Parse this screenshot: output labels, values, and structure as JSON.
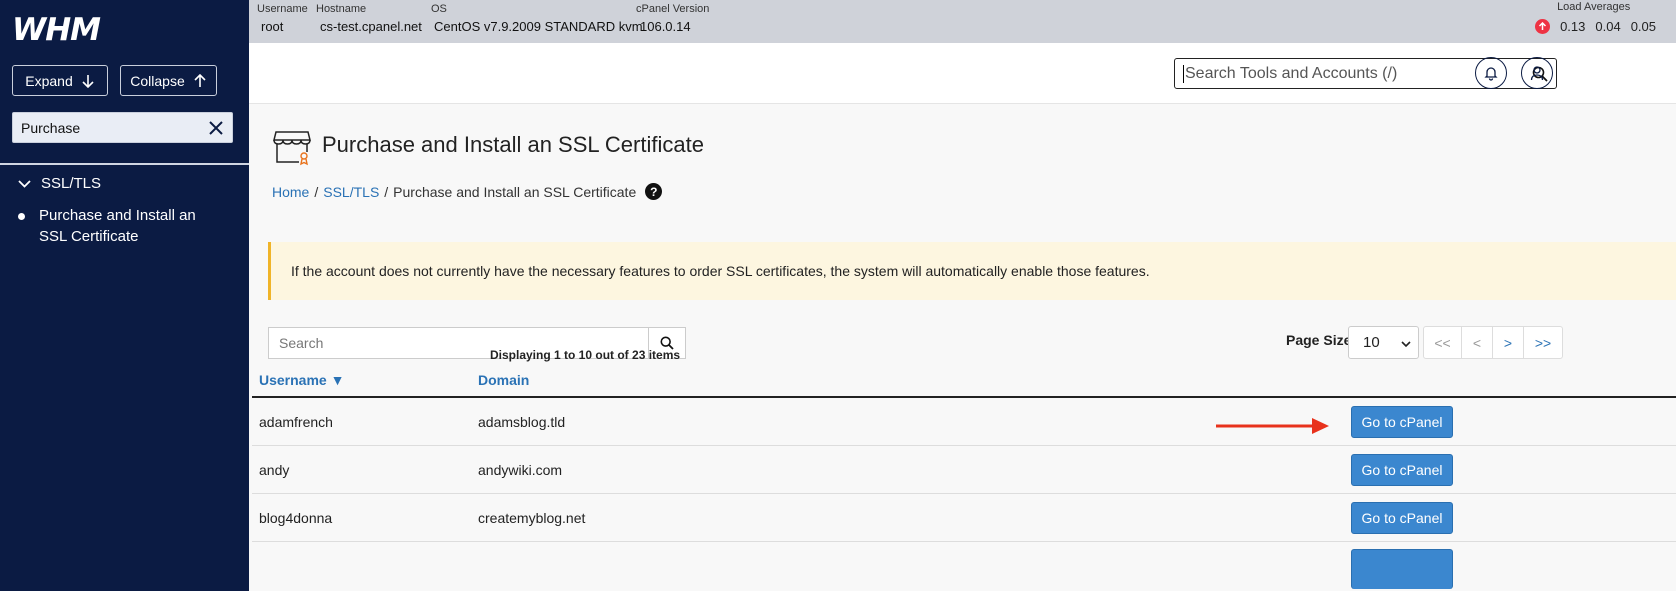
{
  "sidebar": {
    "logo": "WHM",
    "expand_label": "Expand",
    "collapse_label": "Collapse",
    "filter_value": "Purchase",
    "group_label": "SSL/TLS",
    "item_label": "Purchase and Install an SSL Certificate"
  },
  "topbar": {
    "username_key": "Username",
    "username": "root",
    "hostname_key": "Hostname",
    "hostname": "cs-test.cpanel.net",
    "os_key": "OS",
    "os": "CentOS v7.9.2009 STANDARD kvm",
    "version_key": "cPanel Version",
    "version": "106.0.14",
    "load_key": "Load Averages",
    "load": [
      "0.13",
      "0.04",
      "0.05"
    ]
  },
  "header": {
    "search_placeholder": "Search Tools and Accounts (/)"
  },
  "page": {
    "title": "Purchase and Install an SSL Certificate",
    "breadcrumb": [
      "Home",
      "SSL/TLS",
      "Purchase and Install an SSL Certificate"
    ],
    "help": "?",
    "notice": "If the account does not currently have the necessary features to order SSL certificates, the system will automatically enable those features."
  },
  "table": {
    "search_placeholder": "Search",
    "page_size_label": "Page Size",
    "page_size": "10",
    "pager": [
      "<<",
      "<",
      ">",
      ">>"
    ],
    "displaying": "Displaying 1 to 10 out of 23 items",
    "col_username": "Username ▼",
    "col_domain": "Domain",
    "action_label": "Go to cPanel",
    "rows": [
      {
        "username": "adamfrench",
        "domain": "adamsblog.tld"
      },
      {
        "username": "andy",
        "domain": "andywiki.com"
      },
      {
        "username": "blog4donna",
        "domain": "createmyblog.net"
      }
    ]
  },
  "colors": {
    "sidebar_bg": "#0b1b43",
    "link": "#2a72b5",
    "primary_button": "#3b87cf",
    "notice_bg": "#fdf6e0",
    "arrow": "#e8321c"
  }
}
